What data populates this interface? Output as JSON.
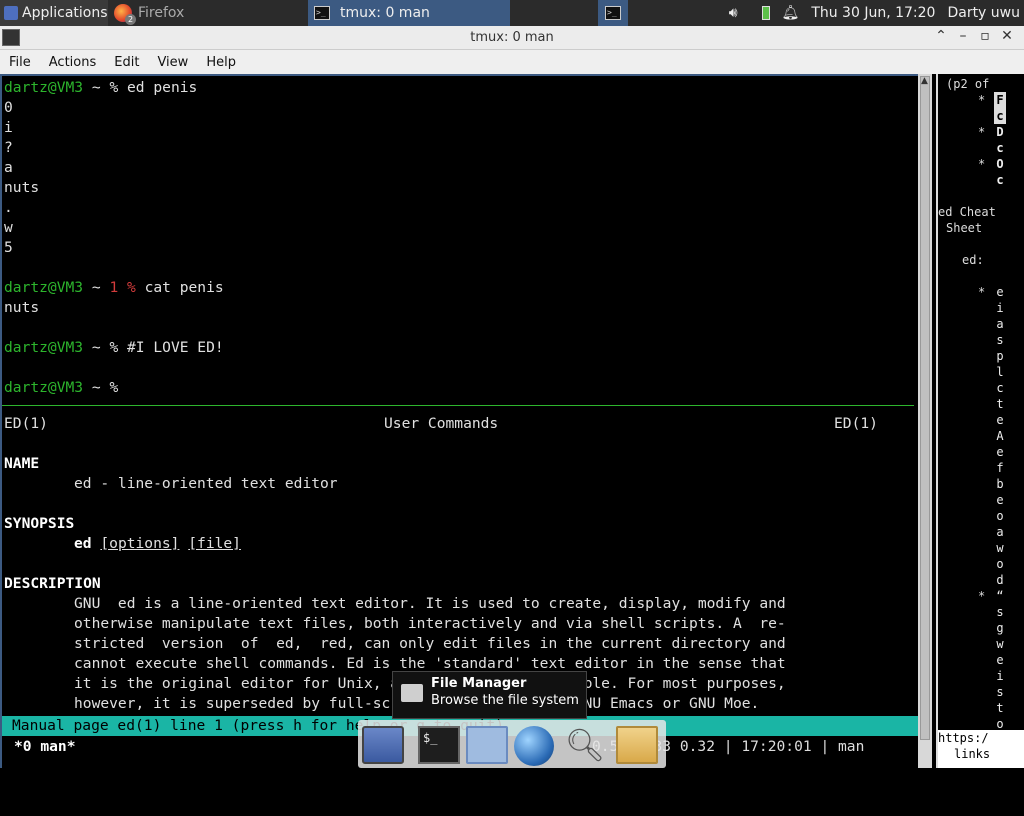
{
  "panel": {
    "applications": "Applications",
    "firefox_label": "Firefox",
    "firefox_count": "2",
    "tmux_task": "tmux: 0 man",
    "datetime": "Thu 30 Jun, 17:20",
    "user": "Darty uwu"
  },
  "window": {
    "title": "tmux: 0 man",
    "menu": [
      "File",
      "Actions",
      "Edit",
      "View",
      "Help"
    ]
  },
  "shell": {
    "prompt_user": "dartz@VM3",
    "prompt_tilde": " ~ ",
    "cmd1": "% ed penis",
    "ed_lines": [
      "0",
      "i",
      "?",
      "a",
      "nuts",
      ".",
      "w",
      "5"
    ],
    "exit_code": "1 %",
    "cmd2": " cat penis",
    "cat_out": "nuts",
    "cmd3": "% #I LOVE ED!",
    "cmd4": "%"
  },
  "man": {
    "header_left": "ED(1)",
    "header_center": "User Commands",
    "header_right": "ED(1)",
    "name_heading": "NAME",
    "name_text": "ed - line-oriented text editor",
    "synopsis_heading": "SYNOPSIS",
    "syn_cmd": "ed",
    "syn_opt": "[options]",
    "syn_file": "[file]",
    "desc_heading": "DESCRIPTION",
    "desc_lines": [
      "GNU  ed is a line-oriented text editor. It is used to create, display, modify and",
      "otherwise manipulate text files, both interactively and via shell scripts. A  re-",
      "stricted  version  of  ed,  red, can only edit files in the current directory and",
      "cannot execute shell commands. Ed is the 'standard' text editor in the sense that",
      "it is the original editor for Unix, and thus widely available. For most purposes,",
      "however, it is superseded by full-screen editors such as GNU Emacs or GNU Moe."
    ],
    "status": "Manual page ed(1) line 1 (press h for help or q to quit)"
  },
  "tmux": {
    "window": "*0 man*",
    "right": "0.53 0.33 0.32 | 17:20:01 | man"
  },
  "side": {
    "page": "(p2 of",
    "rows": [
      {
        "star": "*",
        "ch": "F"
      },
      {
        "star": "",
        "ch": "c"
      },
      {
        "star": "*",
        "ch": "D"
      },
      {
        "star": "",
        "ch": "c"
      },
      {
        "star": "*",
        "ch": "O"
      },
      {
        "star": "",
        "ch": "c"
      }
    ],
    "cheat1": "ed Cheat",
    "cheat2": "Sheet",
    "ed_label": "ed:",
    "col_letters": [
      "e",
      "i",
      "a",
      "s",
      "p",
      "l",
      "c",
      "t",
      "e",
      "A",
      "e",
      "f",
      "b",
      "e",
      "o",
      "a",
      "w",
      "o",
      "d",
      "“",
      "s",
      "g",
      "w",
      "e",
      "i",
      "s",
      "t",
      "o"
    ],
    "link1": "https:/",
    "link2": "links"
  },
  "tooltip": {
    "title": "File Manager",
    "subtitle": "Browse the file system"
  },
  "dock": {
    "terminal_glyph": "$_"
  }
}
